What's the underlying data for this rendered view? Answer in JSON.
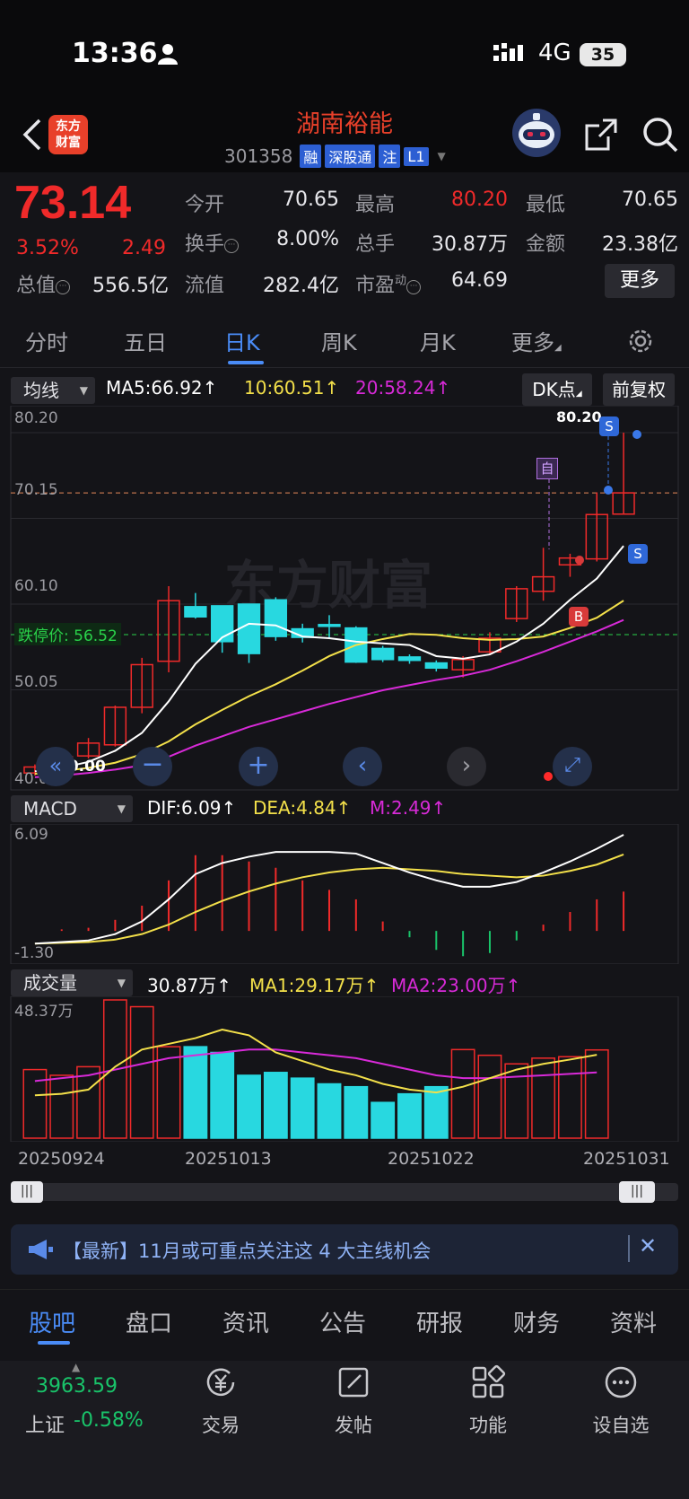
{
  "status_bar": {
    "time": "13:36",
    "network": "4G",
    "battery": "35"
  },
  "header": {
    "stock_name": "湖南裕能",
    "stock_code": "301358",
    "tags": [
      "融",
      "深股通",
      "注",
      "L1"
    ],
    "logo_line1": "东方",
    "logo_line2": "财富"
  },
  "quote": {
    "price": "73.14",
    "change_pct": "3.52%",
    "change": "2.49",
    "fields": [
      {
        "label": "今开",
        "value": "70.65"
      },
      {
        "label": "最高",
        "value": "80.20"
      },
      {
        "label": "最低",
        "value": "70.65"
      },
      {
        "label": "换手",
        "value": "8.00%"
      },
      {
        "label": "总手",
        "value": "30.87万"
      },
      {
        "label": "金额",
        "value": "23.38亿"
      },
      {
        "label": "总值",
        "value": "556.5亿"
      },
      {
        "label": "流值",
        "value": "282.4亿"
      },
      {
        "label": "市盈",
        "value": "64.69"
      }
    ],
    "pe_superscript": "动",
    "more": "更多"
  },
  "period_tabs": [
    "分时",
    "五日",
    "日K",
    "周K",
    "月K",
    "更多"
  ],
  "active_period": "日K",
  "chart_toolbar": {
    "indicator": "均线",
    "ma5": "MA5:66.92↑",
    "ma10": "10:60.51↑",
    "ma20": "20:58.24↑",
    "dk_button": "DK点",
    "adjust_button": "前复权"
  },
  "main_axis": [
    "80.20",
    "70.15",
    "60.10",
    "50.05",
    "40.00"
  ],
  "limit_down_label": "跌停价: 56.52",
  "high_marker": "80.20",
  "low_marker": "40.00",
  "signals": {
    "zi": "自",
    "s": "S",
    "b": "B"
  },
  "macd": {
    "name": "MACD",
    "dif": "DIF:6.09↑",
    "dea": "DEA:4.84↑",
    "m": "M:2.49↑",
    "axis_top": "6.09",
    "axis_bottom": "-1.30"
  },
  "volume": {
    "name": "成交量",
    "vol": "30.87万↑",
    "ma1": "MA1:29.17万↑",
    "ma2": "MA2:23.00万↑",
    "axis_top": "48.37万"
  },
  "dates": [
    "20250924",
    "20251013",
    "20251022",
    "20251031"
  ],
  "news": {
    "text": "【最新】11月或可重点关注这 4 大主线机会"
  },
  "bottom_tabs": [
    "股吧",
    "盘口",
    "资讯",
    "公告",
    "研报",
    "财务",
    "资料"
  ],
  "index": {
    "value": "3963.59",
    "name": "上证",
    "pct": "-0.58%"
  },
  "nav": [
    "交易",
    "发帖",
    "功能",
    "设自选"
  ],
  "colors": {
    "up": "#f02a2a",
    "down": "#28d8e0",
    "ma5": "#ffffff",
    "ma10": "#f3e04a",
    "ma20": "#d82ad8",
    "accent": "#4a8cf7"
  },
  "chart_data": {
    "type": "candlestick",
    "dates": [
      "20250924",
      "20250925",
      "20250926",
      "20250929",
      "20250930",
      "20251009",
      "20251010",
      "20251013",
      "20251014",
      "20251015",
      "20251016",
      "20251017",
      "20251020",
      "20251021",
      "20251022",
      "20251023",
      "20251024",
      "20251027",
      "20251028",
      "20251029",
      "20251030",
      "20251031"
    ],
    "candles": [
      {
        "o": 40.3,
        "h": 41.3,
        "l": 40.0,
        "c": 41.0
      },
      {
        "o": 41.0,
        "h": 42.7,
        "l": 40.6,
        "c": 42.2
      },
      {
        "o": 42.3,
        "h": 44.4,
        "l": 42.0,
        "c": 43.8
      },
      {
        "o": 43.6,
        "h": 48.2,
        "l": 43.4,
        "c": 48.0
      },
      {
        "o": 48.0,
        "h": 53.8,
        "l": 47.3,
        "c": 53.0
      },
      {
        "o": 53.4,
        "h": 62.2,
        "l": 52.1,
        "c": 60.5
      },
      {
        "o": 59.8,
        "h": 61.4,
        "l": 58.4,
        "c": 58.6
      },
      {
        "o": 59.9,
        "h": 59.9,
        "l": 54.4,
        "c": 55.7
      },
      {
        "o": 60.1,
        "h": 60.1,
        "l": 53.2,
        "c": 54.3
      },
      {
        "o": 60.6,
        "h": 60.9,
        "l": 55.8,
        "c": 56.3
      },
      {
        "o": 57.2,
        "h": 57.8,
        "l": 55.6,
        "c": 56.2
      },
      {
        "o": 57.7,
        "h": 58.8,
        "l": 56.0,
        "c": 57.6
      },
      {
        "o": 57.3,
        "h": 57.5,
        "l": 53.2,
        "c": 53.3
      },
      {
        "o": 54.9,
        "h": 55.2,
        "l": 53.3,
        "c": 53.6
      },
      {
        "o": 53.9,
        "h": 54.2,
        "l": 53.1,
        "c": 53.5
      },
      {
        "o": 53.2,
        "h": 53.5,
        "l": 52.2,
        "c": 52.6
      },
      {
        "o": 52.4,
        "h": 54.0,
        "l": 51.5,
        "c": 53.6
      },
      {
        "o": 54.5,
        "h": 56.8,
        "l": 54.2,
        "c": 56.1
      },
      {
        "o": 58.4,
        "h": 62.2,
        "l": 58.0,
        "c": 61.9
      },
      {
        "o": 61.6,
        "h": 66.7,
        "l": 60.5,
        "c": 63.3
      },
      {
        "o": 64.7,
        "h": 66.0,
        "l": 63.3,
        "c": 65.5
      },
      {
        "o": 65.4,
        "h": 73.2,
        "l": 65.1,
        "c": 70.6
      },
      {
        "o": 70.65,
        "h": 80.2,
        "l": 70.65,
        "c": 73.14
      }
    ],
    "ma5": [
      40.5,
      40.9,
      41.6,
      42.9,
      45.0,
      48.7,
      53.1,
      56.2,
      57.8,
      57.6,
      56.3,
      56.1,
      55.7,
      55.5,
      55.3,
      54.0,
      53.7,
      54.2,
      55.7,
      57.8,
      60.6,
      63.1,
      66.92
    ],
    "ma10": [
      40.2,
      40.5,
      40.9,
      41.5,
      42.5,
      44.0,
      46.0,
      47.7,
      49.3,
      50.7,
      52.3,
      54.0,
      55.3,
      56.0,
      56.6,
      56.5,
      56.1,
      55.9,
      56.0,
      56.3,
      57.3,
      58.5,
      60.51
    ],
    "ma20": [
      39.8,
      40.0,
      40.3,
      40.7,
      41.2,
      42.2,
      43.5,
      44.6,
      45.7,
      46.6,
      47.5,
      48.4,
      49.2,
      50.0,
      50.6,
      51.2,
      51.7,
      52.4,
      53.4,
      54.5,
      55.7,
      56.9,
      58.24
    ],
    "macd": {
      "dif": [
        -0.8,
        -0.7,
        -0.6,
        -0.2,
        0.6,
        2.0,
        3.6,
        4.3,
        4.7,
        5.0,
        5.0,
        5.0,
        4.9,
        4.3,
        3.7,
        3.2,
        2.8,
        2.8,
        3.1,
        3.7,
        4.4,
        5.2,
        6.09
      ],
      "dea": [
        -0.8,
        -0.75,
        -0.7,
        -0.55,
        -0.2,
        0.4,
        1.2,
        1.9,
        2.5,
        3.0,
        3.4,
        3.7,
        3.9,
        4.0,
        3.9,
        3.8,
        3.6,
        3.5,
        3.4,
        3.5,
        3.8,
        4.2,
        4.84
      ],
      "m": [
        0,
        0.1,
        0.2,
        0.7,
        1.6,
        3.2,
        4.8,
        4.8,
        4.4,
        4.0,
        3.2,
        2.6,
        2.0,
        0.6,
        -0.4,
        -1.2,
        -1.6,
        -1.4,
        -0.6,
        0.4,
        1.2,
        2.0,
        2.49
      ]
    },
    "volume": {
      "vol": [
        24.0,
        22.0,
        25.0,
        48.37,
        46.0,
        32.0,
        32.0,
        30.0,
        22.0,
        23.0,
        21.0,
        19.0,
        18.0,
        12.5,
        15.5,
        18.0,
        31.0,
        29.0,
        26.0,
        28.0,
        28.5,
        30.87
      ],
      "ma1": [
        15.0,
        15.5,
        17.0,
        25.0,
        31.0,
        33.0,
        35.0,
        38.0,
        36.0,
        30.0,
        27.0,
        24.0,
        22.0,
        19.0,
        17.0,
        16.0,
        18.0,
        21.0,
        24.0,
        26.0,
        27.5,
        29.17
      ],
      "ma2": [
        20.0,
        21.0,
        22.0,
        24.0,
        26.0,
        28.0,
        29.0,
        30.0,
        31.0,
        31.0,
        30.0,
        29.0,
        28.0,
        26.0,
        24.0,
        22.0,
        21.0,
        21.0,
        21.5,
        22.0,
        22.5,
        23.0
      ],
      "ylim": [
        0,
        48.37
      ]
    },
    "ylim": [
      40.0,
      80.2
    ],
    "macd_ylim": [
      -1.3,
      6.09
    ]
  }
}
